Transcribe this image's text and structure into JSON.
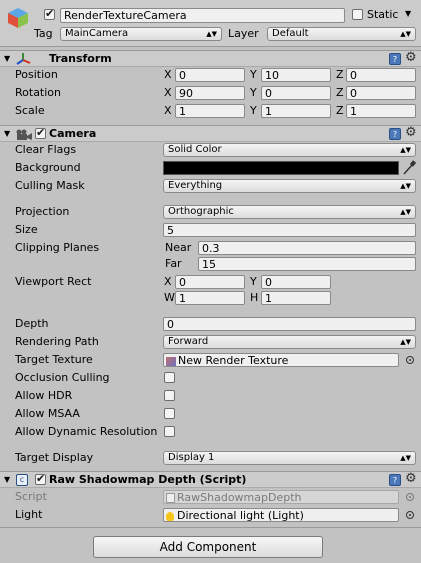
{
  "gameobject": {
    "name": "RenderTextureCamera",
    "active": true,
    "static_label": "Static",
    "static_checked": false,
    "tag_label": "Tag",
    "tag_value": "MainCamera",
    "layer_label": "Layer",
    "layer_value": "Default"
  },
  "transform": {
    "title": "Transform",
    "position_label": "Position",
    "rotation_label": "Rotation",
    "scale_label": "Scale",
    "axis_x": "X",
    "axis_y": "Y",
    "axis_z": "Z",
    "position": {
      "x": "0",
      "y": "10",
      "z": "0"
    },
    "rotation": {
      "x": "90",
      "y": "0",
      "z": "0"
    },
    "scale": {
      "x": "1",
      "y": "1",
      "z": "1"
    }
  },
  "camera": {
    "title": "Camera",
    "enabled": true,
    "clear_flags_label": "Clear Flags",
    "clear_flags_value": "Solid Color",
    "background_label": "Background",
    "background_color": "#000000",
    "culling_mask_label": "Culling Mask",
    "culling_mask_value": "Everything",
    "projection_label": "Projection",
    "projection_value": "Orthographic",
    "size_label": "Size",
    "size_value": "5",
    "clipping_label": "Clipping Planes",
    "near_label": "Near",
    "near_value": "0.3",
    "far_label": "Far",
    "far_value": "15",
    "viewport_label": "Viewport Rect",
    "vp_x_label": "X",
    "vp_y_label": "Y",
    "vp_w_label": "W",
    "vp_h_label": "H",
    "vp_x": "0",
    "vp_y": "0",
    "vp_w": "1",
    "vp_h": "1",
    "depth_label": "Depth",
    "depth_value": "0",
    "rendering_path_label": "Rendering Path",
    "rendering_path_value": "Forward",
    "target_texture_label": "Target Texture",
    "target_texture_value": "New Render Texture",
    "occlusion_label": "Occlusion Culling",
    "hdr_label": "Allow HDR",
    "msaa_label": "Allow MSAA",
    "dynres_label": "Allow Dynamic Resolution",
    "target_display_label": "Target Display",
    "target_display_value": "Display 1"
  },
  "shadow_script": {
    "title": "Raw Shadowmap Depth (Script)",
    "enabled": true,
    "script_label": "Script",
    "script_value": "RawShadowmapDepth",
    "light_label": "Light",
    "light_value": "Directional light (Light)"
  },
  "add_component_label": "Add Component",
  "colors": {
    "panel": "#c2c2c2",
    "header": "#cbcbcb",
    "help": "#4a78b8"
  }
}
